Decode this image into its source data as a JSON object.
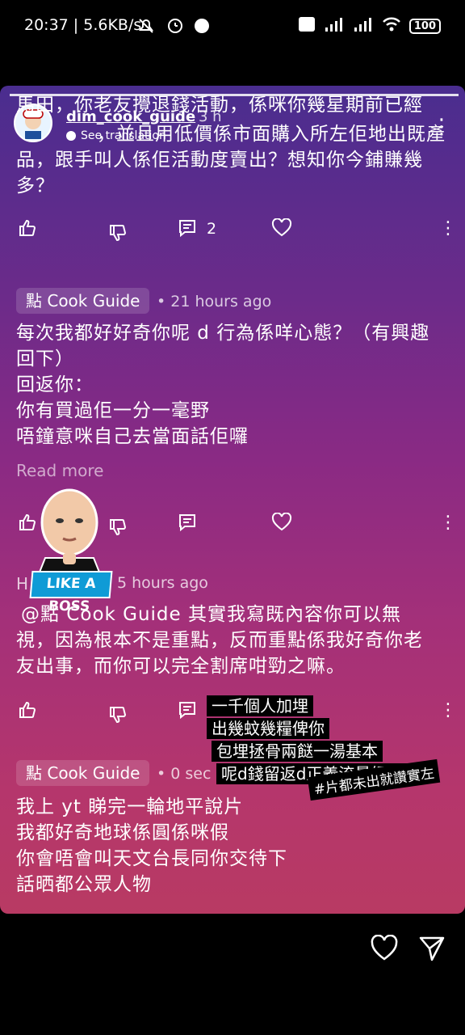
{
  "status": {
    "time_speed": "20:37 | 5.6KB/s",
    "battery": "100"
  },
  "story": {
    "username": "dim_cook_guide",
    "age": "3 h",
    "see_translation": "See translation"
  },
  "comment1": {
    "text_line1": "馬田，你老友攪退錢活動，係咪你幾星期前已經",
    "text_line2": "，並且用低價係市面購入所左佢地出既產",
    "text_line3": "品，跟手叫人係佢活動度賣出？想知你今鋪賺幾",
    "text_line4": "多？",
    "reply_count": "2"
  },
  "comment2": {
    "author": "點 Cook Guide",
    "time": "• 21 hours ago",
    "line1": "每次我都好好奇你呢 d 行為係咩心態？（有興趣",
    "line2": "回下）",
    "line3": "回返你：",
    "line4": "你有買過佢一分一毫野",
    "line5": "唔鐘意咪自己去當面話佢囉",
    "read_more": "Read more"
  },
  "comment3": {
    "author_initial": "H",
    "time": "5 hours ago",
    "line1": "@點 Cook Guide  其實我寫既內容你可以無",
    "line2": "視，因為根本不是重點，反而重點係我好奇你老",
    "line3": "友出事，而你可以完全割席咁勁之嘛。"
  },
  "comment4": {
    "author": "點 Cook Guide",
    "time": "• 0 sec",
    "line1": "我上 yt 睇完一輪地平說片",
    "line2": "我都好奇地球係圓係咪假",
    "line3": "你會唔會叫天文台長同你交待下",
    "line4": "話晒都公眾人物"
  },
  "sticker": {
    "label": "LIKE A BOSS"
  },
  "overlay": {
    "line1": "一千個人加埋",
    "line2": "出幾蚊幾糧俾你",
    "line3": "包埋拯骨兩餸一湯基本",
    "line4": "呢d錢留返d正義流量師賺啦",
    "hashtag": "#片都未出就讚實左"
  }
}
